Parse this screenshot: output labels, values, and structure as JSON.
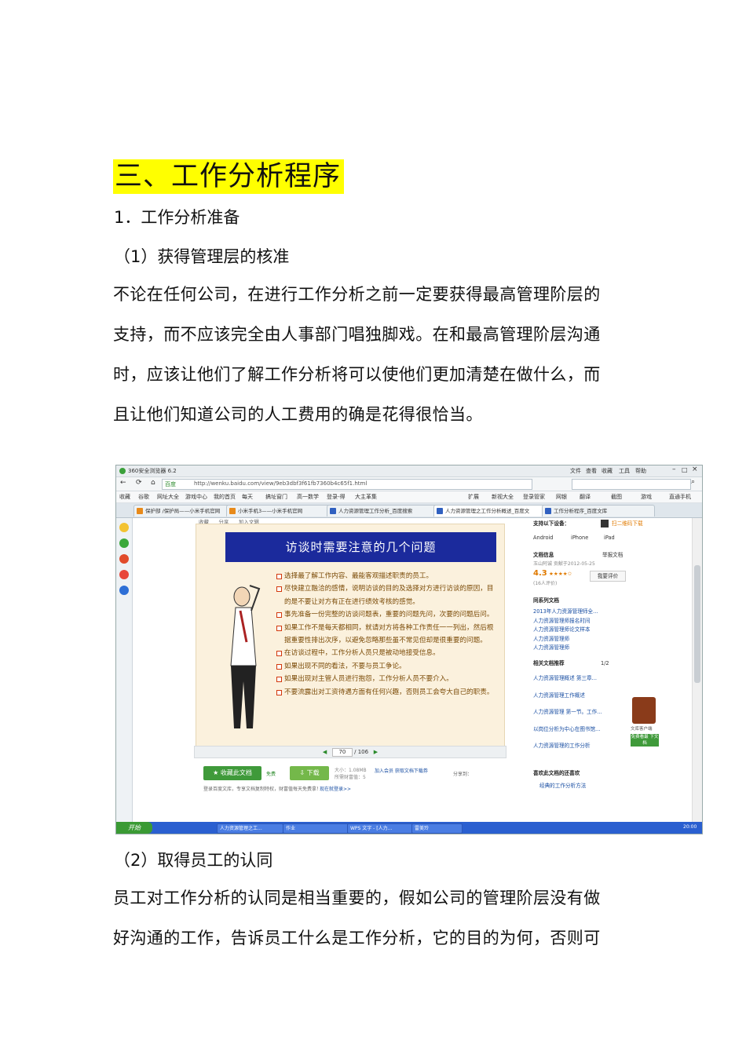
{
  "heading": "三、工作分析程序",
  "section1": "1．工作分析准备",
  "section1_1": "（1）获得管理层的核准",
  "paragraph1": [
    "不论在任何公司，在进行工作分析之前一定要获得最高管理阶层的",
    "支持，而不应该完全由人事部门唱独脚戏。在和最高管理阶层沟通",
    "时，应该让他们了解工作分析将可以使他们更加清楚在做什么，而",
    "且让他们知道公司的人工费用的确是花得很恰当。"
  ],
  "section1_2": "（2）取得员工的认同",
  "paragraph2": [
    "员工对工作分析的认同是相当重要的，假如公司的管理阶层没有做",
    "好沟通的工作，告诉员工什么是工作分析，它的目的为何，否则可"
  ],
  "screenshot": {
    "browser_title": "360安全浏览器 6.2",
    "menu": [
      "文件",
      "查看",
      "收藏",
      "工具",
      "帮助"
    ],
    "url": "http://wenku.baidu.com/view/9eb3dbf3f61fb7360b4c65f1.html",
    "search_engine": "百度",
    "favorites": [
      "收藏",
      "谷歌",
      "网址大全",
      "游戏中心",
      "我的首页",
      "每天",
      "搞址窗门",
      "高一数学",
      "登录-得",
      "大主革集",
      "扩展",
      "新视大全",
      "登录管家",
      "网银",
      "翻译",
      "截图",
      "游戏",
      "直通手机"
    ],
    "tabs": [
      "保护部 /保护局——小米手机官网",
      "小米手机3——小米手机官网",
      "人力资源管理工作分析_百度搜索",
      "人力资源管理之工作分析概述_百度文",
      "工作分析程序_百度文库"
    ],
    "doc_actions": [
      "收藏",
      "分享",
      "加入文辑"
    ],
    "slide": {
      "title": "访谈时需要注意的几个问题",
      "bullets": [
        "选择最了解工作内容、最能客观描述职责的员工。",
        "尽快建立融洽的感情，说明访谈的目的及选择对方进行访谈的原因，目的是不要让对方有正在进行绩效考核的感觉。",
        "事先准备一份完整的访谈问题表，重要的问题先问，次要的问题后问。",
        "如果工作不是每天都相同，就请对方将各种工作责任一一列出，然后根据重要性排出次序，以避免忽略那些虽不常见但却是很重要的问题。",
        "在访谈过程中，工作分析人员只是被动地接受信息。",
        "如果出现不同的看法，不要与员工争论。",
        "如果出现对主管人员进行抱怨，工作分析人员不要介入。",
        "不要流露出对工资待遇方面有任何兴趣，否则员工会夸大自己的职责。"
      ]
    },
    "pager": {
      "page": "70",
      "total": "/ 106"
    },
    "buttons": {
      "collect": "收藏此文档",
      "free": "免费",
      "download": "下载",
      "size": "大小：1.08MB",
      "points": "所需财富值：5",
      "vip": "加入会员 获取文档下载券",
      "share": "分享到：",
      "login_note": "登录百度文库，专享文档复制特权，财富值每天免费拿！",
      "login_link": "现在就登录>>"
    },
    "right_panel": {
      "devices_title": "支持以下设备：",
      "qr": "扫二维码下载",
      "devices": [
        "Android",
        "iPhone",
        "iPad"
      ],
      "info_title": "文档信息",
      "report": "举报文档",
      "contributor": "玉山阿诚 贡献于2012-05-25",
      "rating": "4.3",
      "rating_count": "(16人评价)",
      "rate_btn": "我要评价",
      "series_title": "同系列文档",
      "series": [
        "2013年人力资源管理师全...",
        "人力资源管理师报名时间",
        "人力资源管理师论文样本",
        "人力资源管理师",
        "人力资源管理师"
      ],
      "rec_title": "相关文档推荐",
      "rec_page": "1/2",
      "recs": [
        "人力资源管理概述 第三章...",
        "人力资源管理工作概述",
        "人力资源管理 第一节。工作...",
        "以岗位分析为中心在图书馆...",
        "人力资源管理的工作分析"
      ],
      "like_title": "喜欢此文档的还喜欢",
      "likes": [
        "经典的工作分析方法"
      ],
      "app": "文库客户端",
      "app_btn": "免费看最 下文档"
    },
    "taskbar": {
      "start": "开始",
      "items": [
        "人力资源管理之工...",
        "作业",
        "WPS 文字 - [人力...",
        "雷美玲"
      ],
      "time": "20:00"
    }
  }
}
